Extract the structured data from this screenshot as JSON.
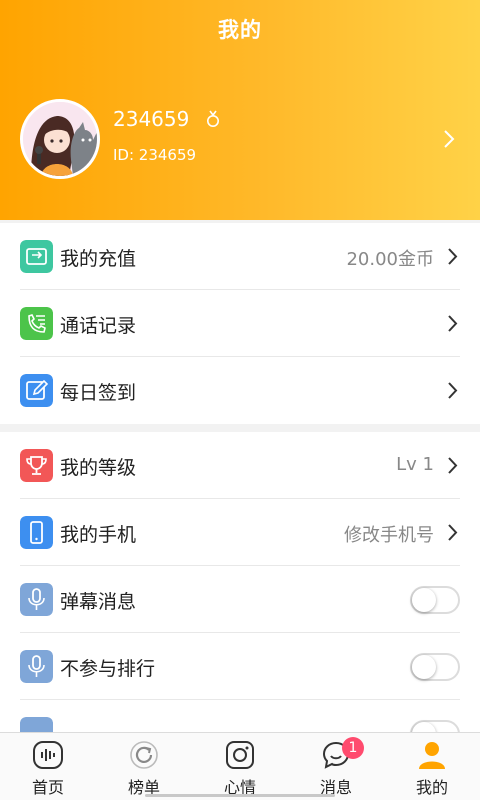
{
  "header": {
    "title": "我的"
  },
  "profile": {
    "username": "234659",
    "user_id": "ID: 234659"
  },
  "group1": [
    {
      "label": "我的充值",
      "value": "20.00金币",
      "icon": "wallet-icon",
      "color": "#3ec7a0"
    },
    {
      "label": "通话记录",
      "value": "",
      "icon": "call-record-icon",
      "color": "#4cc44a"
    },
    {
      "label": "每日签到",
      "value": "",
      "icon": "edit-icon",
      "color": "#3d8ff0"
    }
  ],
  "group2": [
    {
      "label": "我的等级",
      "value": "Lv 1",
      "icon": "trophy-icon",
      "color": "#f25757"
    },
    {
      "label": "我的手机",
      "value": "修改手机号",
      "icon": "phone-icon",
      "color": "#3d8ff0"
    },
    {
      "label": "弹幕消息",
      "toggle": "off",
      "icon": "microphone-icon",
      "color": "#7fa6d8"
    },
    {
      "label": "不参与排行",
      "toggle": "off",
      "icon": "microphone-icon",
      "color": "#7fa6d8"
    }
  ],
  "tabs": [
    {
      "label": "首页",
      "icon": "home-voice-icon"
    },
    {
      "label": "榜单",
      "icon": "ranking-icon"
    },
    {
      "label": "心情",
      "icon": "camera-icon"
    },
    {
      "label": "消息",
      "icon": "message-icon",
      "badge": "1"
    },
    {
      "label": "我的",
      "icon": "user-icon",
      "active": true
    }
  ],
  "colors": {
    "accent": "#ffa400",
    "badge": "#ff4b6e"
  }
}
